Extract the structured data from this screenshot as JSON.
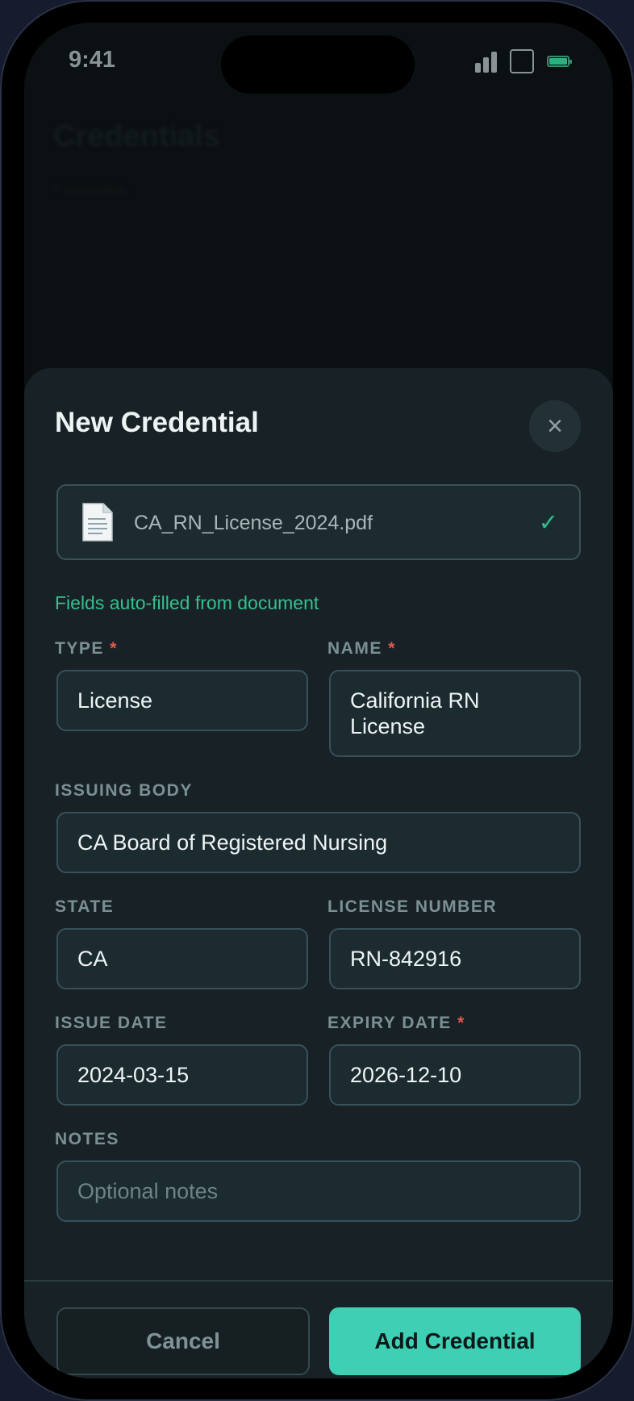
{
  "status_bar": {
    "time": "9:41"
  },
  "background": {
    "title": "Credentials",
    "subtitle": "0 credentials"
  },
  "sheet": {
    "title": "New Credential",
    "close_glyph": "×",
    "file": {
      "name": "CA_RN_License_2024.pdf",
      "icon": "document-icon",
      "status_glyph": "✓"
    },
    "autofill_note": "Fields auto-filled from document",
    "required_mark": "*",
    "fields": {
      "type": {
        "label": "TYPE",
        "value": "License"
      },
      "name": {
        "label": "NAME",
        "value": "California RN License"
      },
      "issuing_body": {
        "label": "ISSUING BODY",
        "value": "CA Board of Registered Nursing"
      },
      "state": {
        "label": "STATE",
        "value": "CA"
      },
      "license_number": {
        "label": "LICENSE NUMBER",
        "value": "RN-842916"
      },
      "issue_date": {
        "label": "ISSUE DATE",
        "value": "2024-03-15"
      },
      "expiry_date": {
        "label": "EXPIRY DATE",
        "value": "2026-12-10"
      },
      "notes": {
        "label": "NOTES",
        "value": "",
        "placeholder": "Optional notes"
      }
    },
    "actions": {
      "cancel_label": "Cancel",
      "add_label": "Add Credential"
    }
  },
  "colors": {
    "accent": "#3ecfb4",
    "success": "#35c08e",
    "required": "#e05a4a",
    "sheet_bg": "#182226"
  }
}
